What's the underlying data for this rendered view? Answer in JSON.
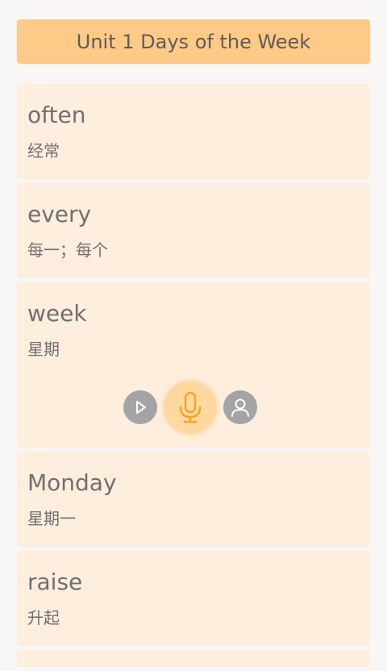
{
  "header": {
    "title": "Unit 1 Days of the Week"
  },
  "words": [
    {
      "word": "often",
      "meaning": "经常"
    },
    {
      "word": "every",
      "meaning": "每一；每个"
    },
    {
      "word": "week",
      "meaning": "星期"
    },
    {
      "word": "Monday",
      "meaning": "星期一"
    },
    {
      "word": "raise",
      "meaning": "升起"
    }
  ],
  "icons": {
    "play": "play-icon",
    "mic": "microphone-icon",
    "user": "user-icon"
  },
  "colors": {
    "header_bg": "#fdca87",
    "card_bg": "#feeedd",
    "text": "#707070",
    "accent": "#f5a623",
    "gray_button": "#a4a4a4"
  }
}
